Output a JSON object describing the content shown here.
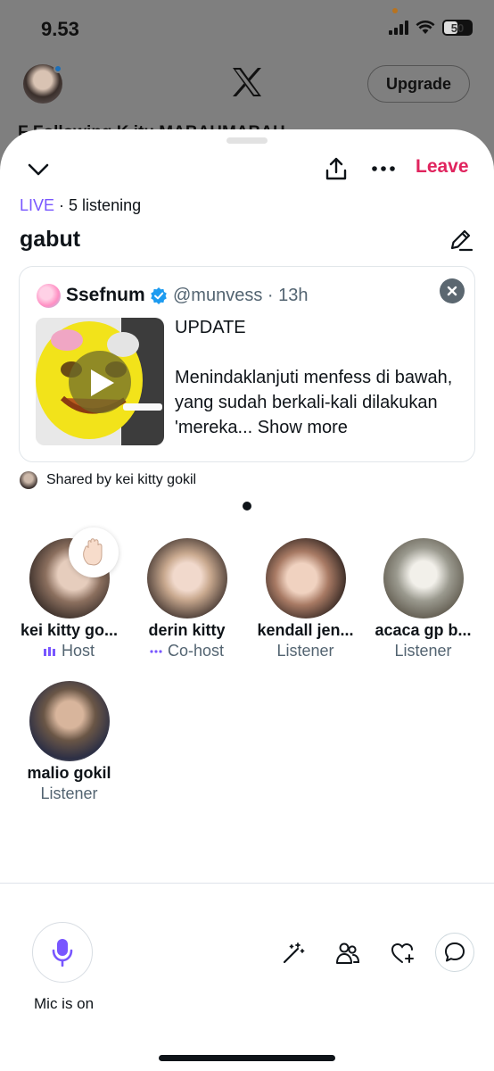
{
  "status_bar": {
    "time": "9.53",
    "battery": "50"
  },
  "home": {
    "upgrade_label": "Upgrade",
    "peek_text": "F          Following     K          itu     MABAHMABAH"
  },
  "space": {
    "leave_label": "Leave",
    "live_label": "LIVE",
    "listening": "· 5 listening",
    "title": "gabut",
    "shared_by": "Shared by kei kitty gokil"
  },
  "tweet": {
    "author": "Ssefnum",
    "handle_time": "@munvess · 13h",
    "text_line1": "UPDATE",
    "text_body": "Menindaklanjuti menfess di bawah, yang sudah berkali-kali dilakukan 'mereka...",
    "show_more": "Show more"
  },
  "participants": [
    {
      "name": "kei kitty go...",
      "role": "Host"
    },
    {
      "name": "derin kitty",
      "role": "Co-host"
    },
    {
      "name": "kendall jen...",
      "role": "Listener"
    },
    {
      "name": "acaca gp b...",
      "role": "Listener"
    },
    {
      "name": "malio gokil",
      "role": "Listener"
    }
  ],
  "controls": {
    "mic_label": "Mic is on"
  },
  "colors": {
    "accent_live": "#7856ff",
    "leave": "#e0245e",
    "verified": "#1d9bf0"
  }
}
